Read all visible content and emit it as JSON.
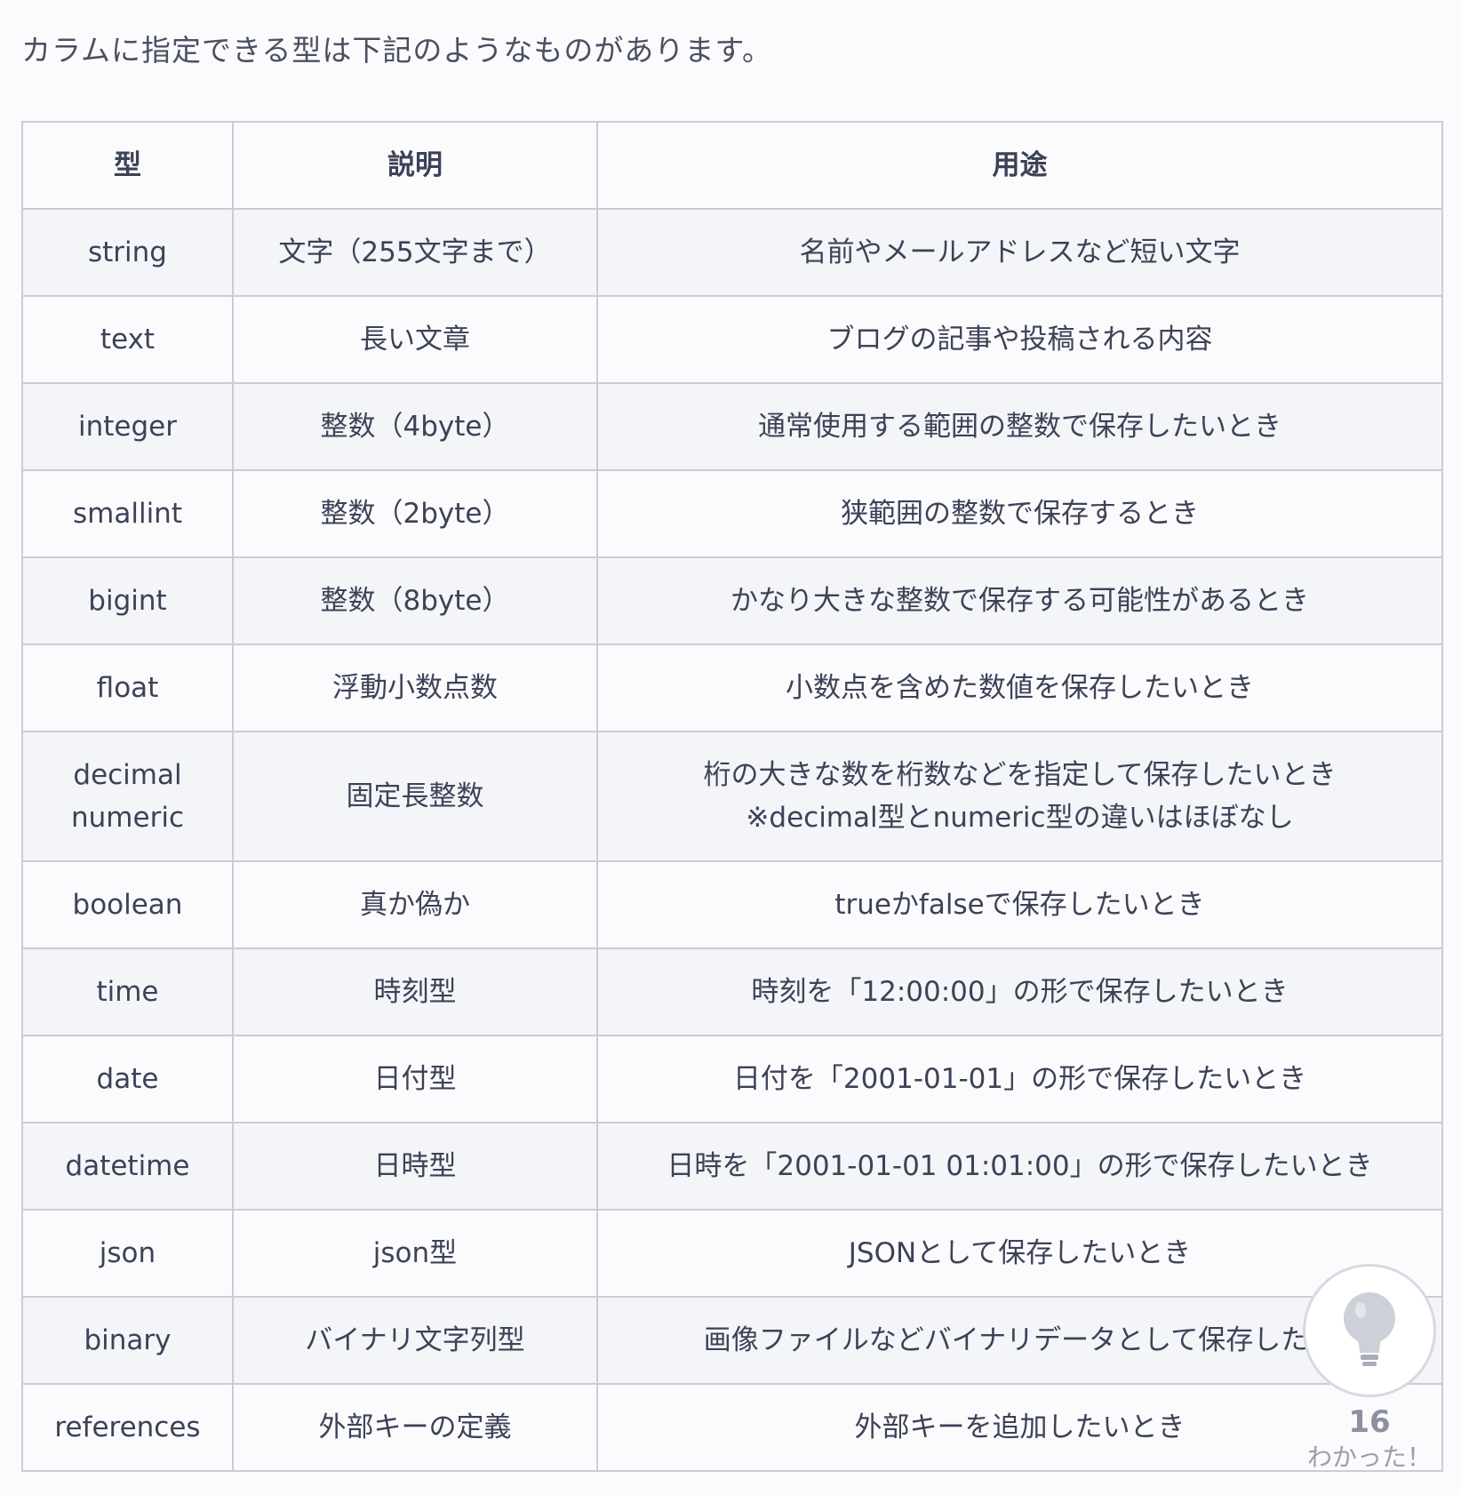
{
  "intro": "カラムに指定できる型は下記のようなものがあります。",
  "table": {
    "headers": [
      "型",
      "説明",
      "用途"
    ],
    "rows": [
      {
        "type": "string",
        "desc": "文字（255文字まで）",
        "use": "名前やメールアドレスなど短い文字"
      },
      {
        "type": "text",
        "desc": "長い文章",
        "use": "ブログの記事や投稿される内容"
      },
      {
        "type": "integer",
        "desc": "整数（4byte）",
        "use": "通常使用する範囲の整数で保存したいとき"
      },
      {
        "type": "smallint",
        "desc": "整数（2byte）",
        "use": "狭範囲の整数で保存するとき"
      },
      {
        "type": "bigint",
        "desc": "整数（8byte）",
        "use": "かなり大きな整数で保存する可能性があるとき"
      },
      {
        "type": "float",
        "desc": "浮動小数点数",
        "use": "小数点を含めた数値を保存したいとき"
      },
      {
        "type": "decimal",
        "type2": "numeric",
        "desc": "固定長整数",
        "use": "桁の大きな数を桁数などを指定して保存したいとき",
        "use2": "※decimal型とnumeric型の違いはほぼなし"
      },
      {
        "type": "boolean",
        "desc": "真か偽か",
        "use": "trueかfalseで保存したいとき"
      },
      {
        "type": "time",
        "desc": "時刻型",
        "use": "時刻を「12:00:00」の形で保存したいとき"
      },
      {
        "type": "date",
        "desc": "日付型",
        "use": "日付を「2001-01-01」の形で保存したいとき"
      },
      {
        "type": "datetime",
        "desc": "日時型",
        "use": "日時を「2001-01-01 01:01:00」の形で保存したいとき"
      },
      {
        "type": "json",
        "desc": "json型",
        "use": "JSONとして保存したいとき"
      },
      {
        "type": "binary",
        "desc": "バイナリ文字列型",
        "use": "画像ファイルなどバイナリデータとして保存したい"
      },
      {
        "type": "references",
        "desc": "外部キーの定義",
        "use": "外部キーを追加したいとき"
      }
    ]
  },
  "like": {
    "icon": "lightbulb-icon",
    "count": "16",
    "label": "わかった！"
  }
}
